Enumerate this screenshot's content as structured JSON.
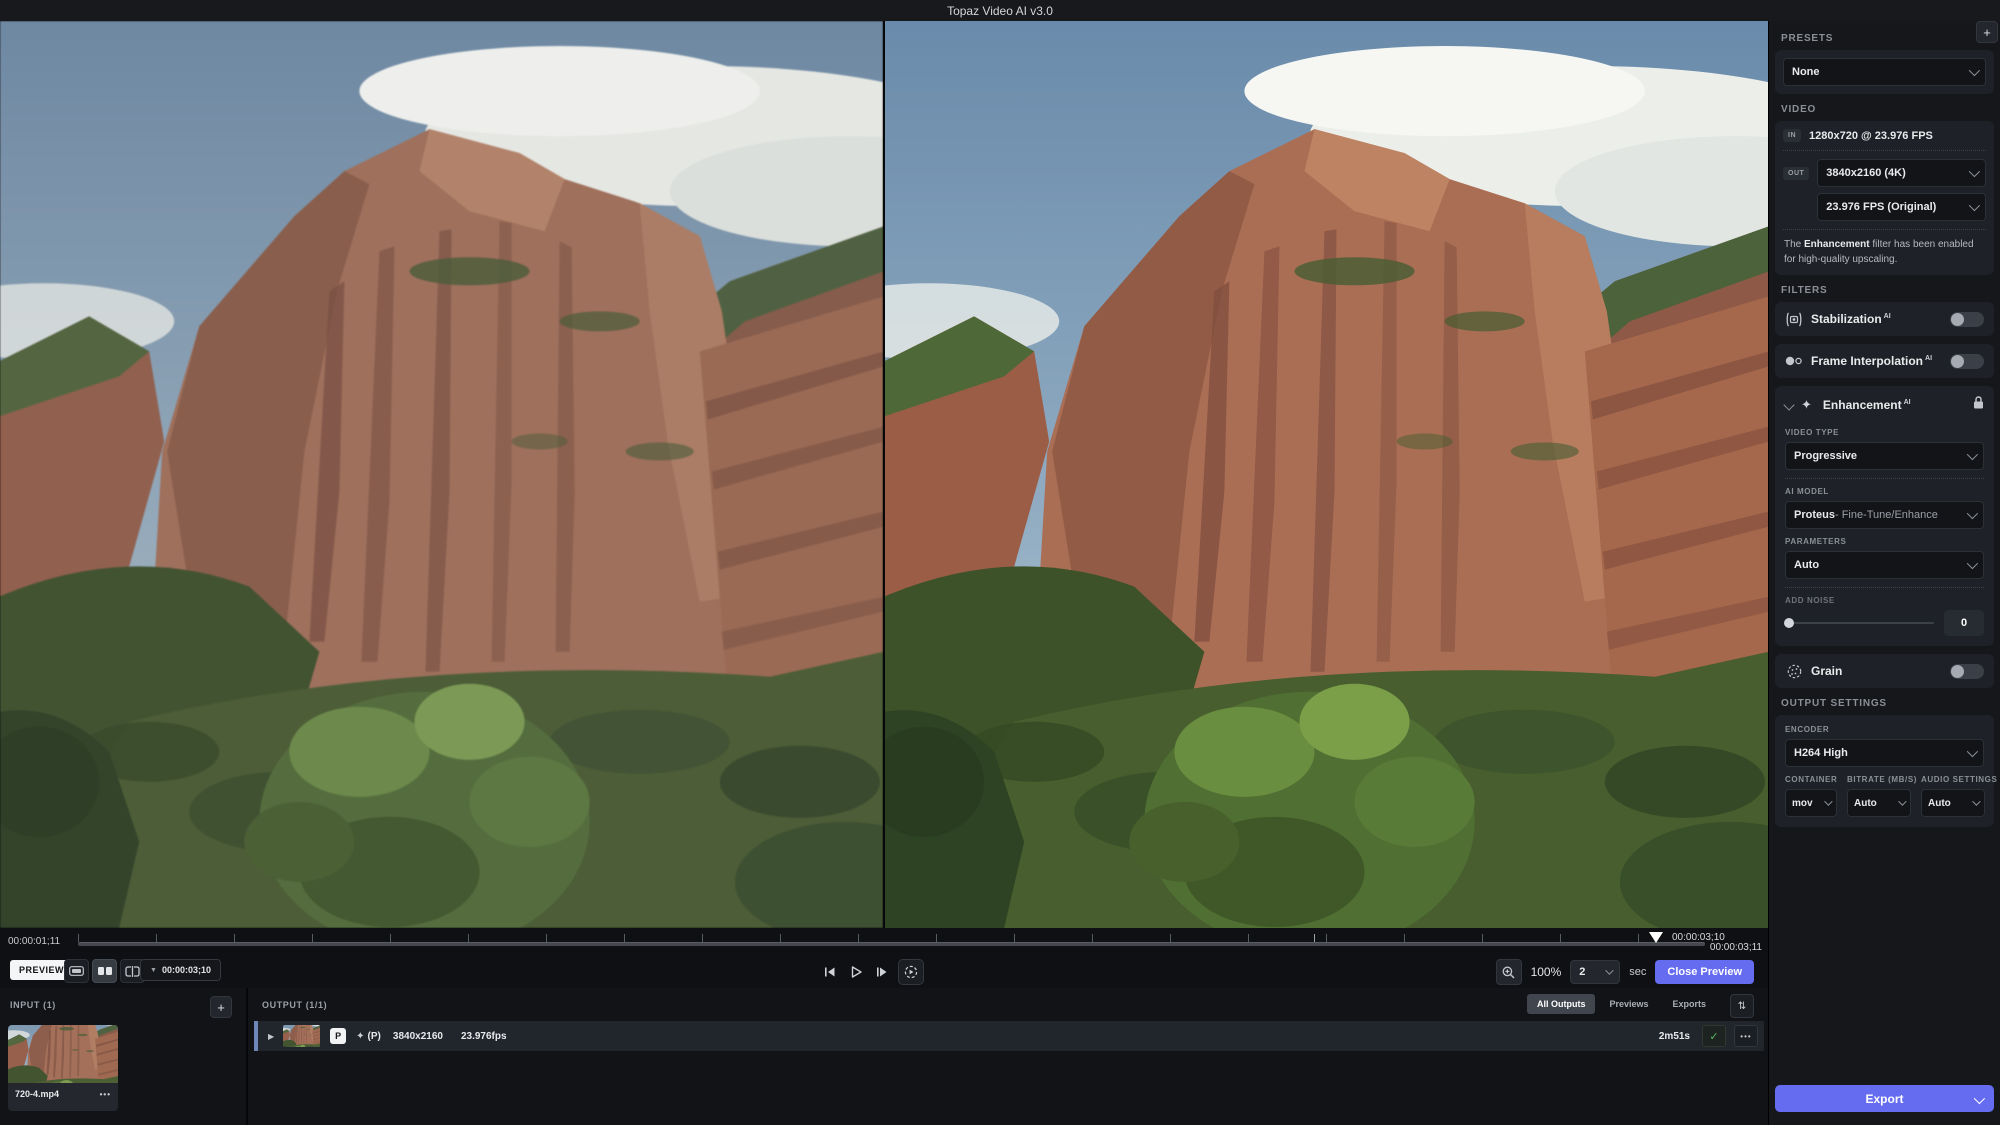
{
  "title_bar": {
    "title": "Topaz Video AI v3.0"
  },
  "panel": {
    "presets": {
      "header": "PRESETS",
      "add": "+",
      "value": "None"
    },
    "video": {
      "header": "VIDEO",
      "in_badge": "IN",
      "in_value": "1280x720 @ 23.976 FPS",
      "out_badge": "OUT",
      "out_resolution": "3840x2160 (4K)",
      "out_fps": "23.976 FPS (Original)",
      "note_pre": "The ",
      "note_bold": "Enhancement",
      "note_post": " filter has been enabled for high-quality upscaling."
    },
    "filters": {
      "header": "FILTERS",
      "stabilization": {
        "label": "Stabilization",
        "ai": "AI"
      },
      "frame_interpolation": {
        "label": "Frame Interpolation",
        "ai": "AI"
      },
      "enhancement": {
        "label": "Enhancement",
        "ai": "AI",
        "video_type_label": "VIDEO TYPE",
        "video_type": "Progressive",
        "ai_model_label": "AI MODEL",
        "ai_model_name": "Proteus",
        "ai_model_desc": " - Fine-Tune/Enhance",
        "parameters_label": "PARAMETERS",
        "parameters": "Auto",
        "add_noise_label": "ADD NOISE",
        "add_noise_value": "0"
      },
      "grain": {
        "label": "Grain"
      }
    },
    "output_settings": {
      "header": "OUTPUT SETTINGS",
      "encoder_label": "ENCODER",
      "encoder": "H264 High",
      "container_label": "CONTAINER",
      "container": "mov",
      "bitrate_label": "BITRATE (MB/S)",
      "bitrate": "Auto",
      "audio_label": "AUDIO SETTINGS",
      "audio": "Auto"
    },
    "export_label": "Export"
  },
  "timeline": {
    "current": "00:00:01;11",
    "playhead": "00:00:03;10",
    "end": "00:00:03;11"
  },
  "toolbar": {
    "preview": "PREVIEW",
    "timecode": "00:00:03;10",
    "zoom": "100%",
    "preview_length": "2",
    "sec_label": "sec",
    "close_preview": "Close Preview"
  },
  "bottom": {
    "input_header": "INPUT (1)",
    "add": "+",
    "input_file": "720-4.mp4",
    "output_header": "OUTPUT (1/1)",
    "tabs": {
      "all": "All Outputs",
      "previews": "Previews",
      "exports": "Exports"
    },
    "row": {
      "badge": "P",
      "ptag": "(P)",
      "resolution": "3840x2160",
      "fps": "23.976fps",
      "duration": "2m51s"
    }
  },
  "icons": {
    "plus": "+",
    "check": "✓",
    "ellipsis": "•••",
    "sort": "⇅",
    "caret_down": "▼",
    "play_small": "▶",
    "sparkle": "✦"
  },
  "colors": {
    "accent": "#666cf0",
    "success": "#58b85c",
    "panel": "#15171b",
    "card": "#1e2127"
  }
}
